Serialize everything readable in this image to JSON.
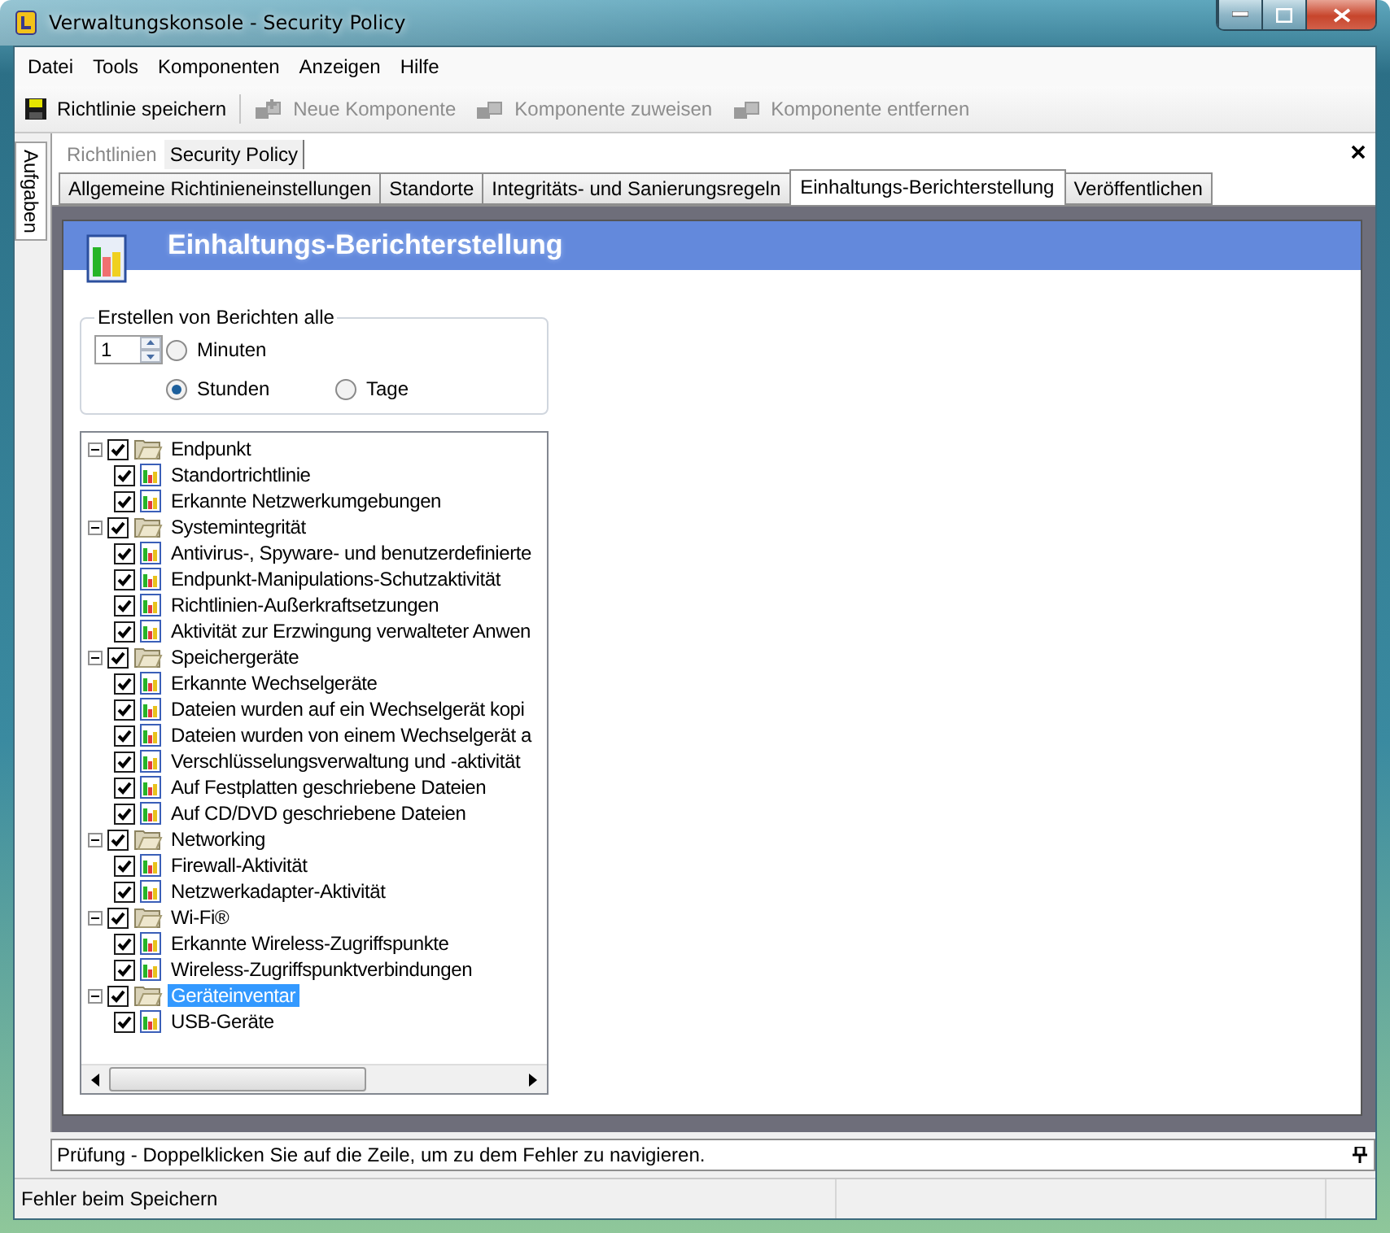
{
  "window": {
    "title": "Verwaltungskonsole - Security Policy"
  },
  "menu": [
    "Datei",
    "Tools",
    "Komponenten",
    "Anzeigen",
    "Hilfe"
  ],
  "toolbar": [
    {
      "kind": "save",
      "label": "Richtlinie speichern",
      "disabled": false
    },
    {
      "kind": "new",
      "label": "Neue Komponente",
      "disabled": true
    },
    {
      "kind": "assign",
      "label": "Komponente zuweisen",
      "disabled": true
    },
    {
      "kind": "remove",
      "label": "Komponente entfernen",
      "disabled": true
    }
  ],
  "side_tab": "Aufgaben",
  "breadcrumb": [
    {
      "label": "Richtlinien",
      "selected": false
    },
    {
      "label": "Security Policy",
      "selected": true
    }
  ],
  "tabs": [
    {
      "label": "Allgemeine Richtinieneinstellungen",
      "selected": false
    },
    {
      "label": "Standorte",
      "selected": false
    },
    {
      "label": "Integritäts- und Sanierungsregeln",
      "selected": false
    },
    {
      "label": "Einhaltungs-Berichterstellung",
      "selected": true
    },
    {
      "label": "Veröffentlichen",
      "selected": false
    }
  ],
  "header": {
    "title": "Einhaltungs-Berichterstellung"
  },
  "schedule": {
    "legend": "Erstellen von Berichten alle",
    "value": "1",
    "options": [
      {
        "label": "Minuten",
        "selected": false
      },
      {
        "label": "Stunden",
        "selected": true
      },
      {
        "label": "Tage",
        "selected": false
      }
    ]
  },
  "tree": [
    {
      "label": "Endpunkt",
      "checked": true,
      "expanded": true,
      "selected": false,
      "children": [
        {
          "label": "Standortrichtlinie",
          "checked": true,
          "selected": false
        },
        {
          "label": "Erkannte Netzwerkumgebungen",
          "checked": true,
          "selected": false
        }
      ]
    },
    {
      "label": "Systemintegrität",
      "checked": true,
      "expanded": true,
      "selected": false,
      "children": [
        {
          "label": "Antivirus-, Spyware- und benutzerdefinierte",
          "checked": true,
          "selected": false
        },
        {
          "label": "Endpunkt-Manipulations-Schutzaktivität",
          "checked": true,
          "selected": false
        },
        {
          "label": "Richtlinien-Außerkraftsetzungen",
          "checked": true,
          "selected": false
        },
        {
          "label": "Aktivität zur Erzwingung verwalteter Anwen",
          "checked": true,
          "selected": false
        }
      ]
    },
    {
      "label": "Speichergeräte",
      "checked": true,
      "expanded": true,
      "selected": false,
      "children": [
        {
          "label": "Erkannte Wechselgeräte",
          "checked": true,
          "selected": false
        },
        {
          "label": "Dateien wurden auf ein Wechselgerät kopi",
          "checked": true,
          "selected": false
        },
        {
          "label": "Dateien wurden von einem Wechselgerät a",
          "checked": true,
          "selected": false
        },
        {
          "label": "Verschlüsselungsverwaltung und -aktivität",
          "checked": true,
          "selected": false
        },
        {
          "label": "Auf Festplatten geschriebene Dateien",
          "checked": true,
          "selected": false
        },
        {
          "label": "Auf CD/DVD geschriebene Dateien",
          "checked": true,
          "selected": false
        }
      ]
    },
    {
      "label": "Networking",
      "checked": true,
      "expanded": true,
      "selected": false,
      "children": [
        {
          "label": "Firewall-Aktivität",
          "checked": true,
          "selected": false
        },
        {
          "label": "Netzwerkadapter-Aktivität",
          "checked": true,
          "selected": false
        }
      ]
    },
    {
      "label": "Wi-Fi®",
      "checked": true,
      "expanded": true,
      "selected": false,
      "children": [
        {
          "label": "Erkannte Wireless-Zugriffspunkte",
          "checked": true,
          "selected": false
        },
        {
          "label": "Wireless-Zugriffspunktverbindungen",
          "checked": true,
          "selected": false
        }
      ]
    },
    {
      "label": "Geräteinventar",
      "checked": true,
      "expanded": true,
      "selected": true,
      "children": [
        {
          "label": "USB-Geräte",
          "checked": true,
          "selected": false
        }
      ]
    }
  ],
  "output_bar": {
    "text": "Prüfung - Doppelklicken Sie auf die Zeile, um zu dem Fehler zu navigieren."
  },
  "status_bar": {
    "text": "Fehler beim Speichern"
  }
}
